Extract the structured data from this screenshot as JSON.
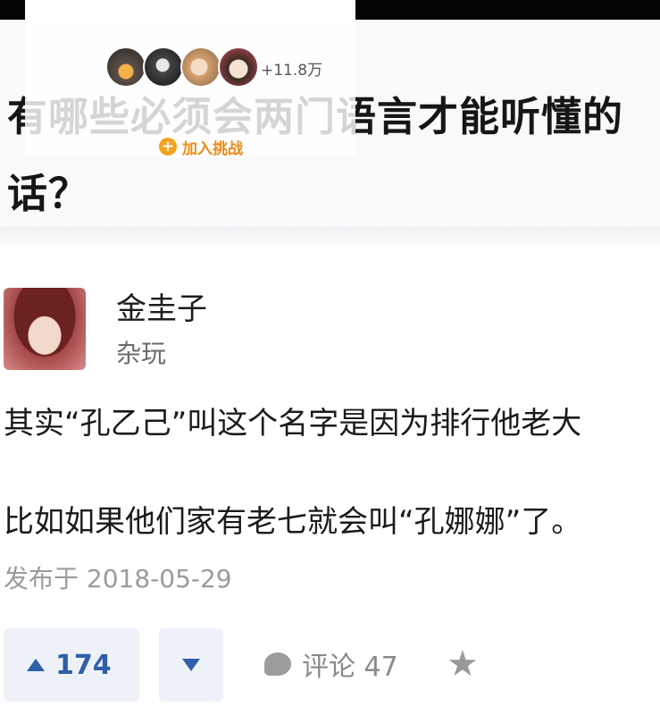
{
  "question": {
    "title": "有哪些必须会两门语言才能听懂的话？",
    "participant_count": "+11.8万",
    "join_label": "加入挑战",
    "join_icon": "plus-icon"
  },
  "answer": {
    "author_name": "金圭子",
    "author_tag": "杂玩",
    "paragraphs": [
      "其实“孔乙己”叫这个名字是因为排行他老大",
      "比如如果他们家有老七就会叫“孔娜娜”了。"
    ],
    "published": "发布于 2018-05-29"
  },
  "actions": {
    "upvote_count": "174",
    "comment_label": "评论 47",
    "icons": [
      "upvote-icon",
      "downvote-icon",
      "comment-icon",
      "star-icon"
    ]
  },
  "colors": {
    "accent": "#2f5fa8",
    "join": "#f08a14",
    "vote_bg": "#eef2f8"
  }
}
